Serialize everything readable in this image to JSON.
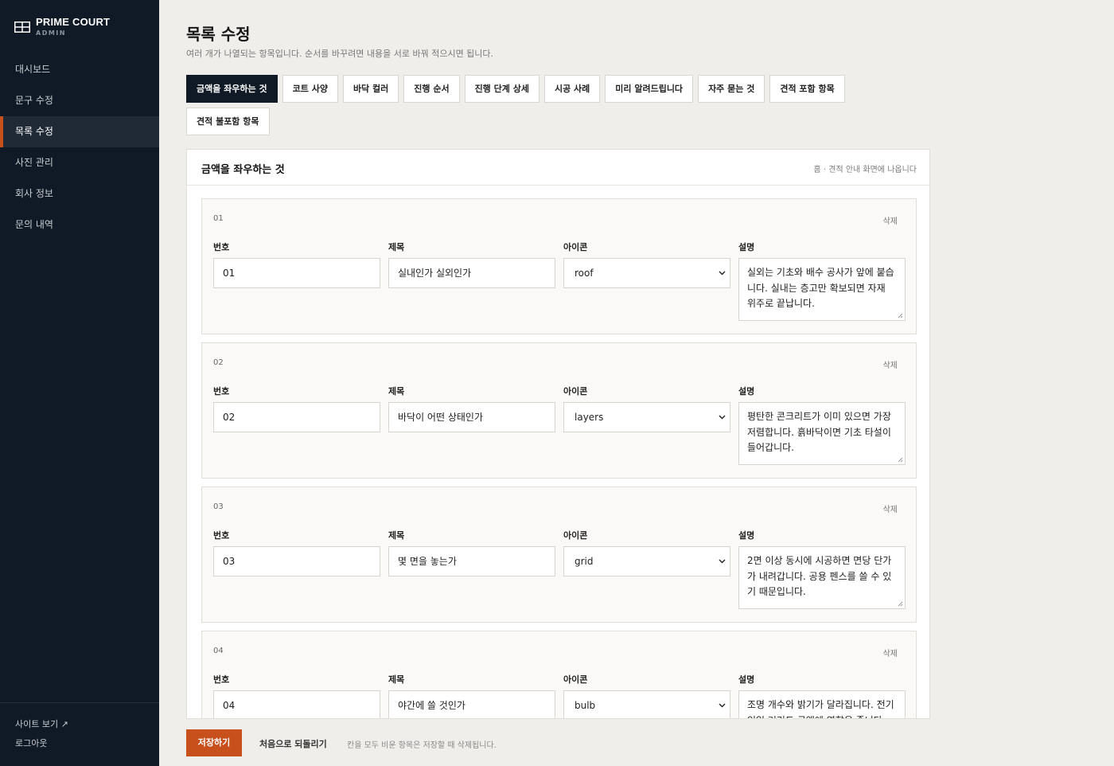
{
  "sidebar": {
    "brand": {
      "name": "PRIME COURT",
      "sub": "ADMIN"
    },
    "nav": [
      {
        "label": "대시보드"
      },
      {
        "label": "문구 수정"
      },
      {
        "label": "목록 수정",
        "active": true
      },
      {
        "label": "사진 관리"
      },
      {
        "label": "회사 정보"
      },
      {
        "label": "문의 내역"
      }
    ],
    "footer": {
      "view_site": "사이트 보기 ↗",
      "logout": "로그아웃"
    }
  },
  "header": {
    "title": "목록 수정",
    "description": "여러 개가 나열되는 항목입니다. 순서를 바꾸려면 내용을 서로 바꿔 적으시면 됩니다."
  },
  "tabs": [
    {
      "label": "금액을 좌우하는 것",
      "active": true
    },
    {
      "label": "코트 사양"
    },
    {
      "label": "바닥 컬러"
    },
    {
      "label": "진행 순서"
    },
    {
      "label": "진행 단계 상세"
    },
    {
      "label": "시공 사례"
    },
    {
      "label": "미리 알려드립니다"
    },
    {
      "label": "자주 묻는 것"
    },
    {
      "label": "견적 포함 항목"
    },
    {
      "label": "견적 불포함 항목"
    }
  ],
  "panel": {
    "title": "금액을 좌우하는 것",
    "note": "홈 · 견적 안내 화면에 나옵니다",
    "labels": {
      "number": "번호",
      "title": "제목",
      "icon": "아이콘",
      "description": "설명"
    },
    "delete_label": "삭제",
    "items": [
      {
        "index": "01",
        "number": "01",
        "title": "실내인가 실외인가",
        "icon": "roof",
        "description": "실외는 기초와 배수 공사가 앞에 붙습니다. 실내는 층고만 확보되면 자재 위주로 끝납니다."
      },
      {
        "index": "02",
        "number": "02",
        "title": "바닥이 어떤 상태인가",
        "icon": "layers",
        "description": "평탄한 콘크리트가 이미 있으면 가장 저렴합니다. 흙바닥이면 기초 타설이 들어갑니다."
      },
      {
        "index": "03",
        "number": "03",
        "title": "몇 면을 놓는가",
        "icon": "grid",
        "description": "2면 이상 동시에 시공하면 면당 단가가 내려갑니다. 공용 펜스를 쓸 수 있기 때문입니다."
      },
      {
        "index": "04",
        "number": "04",
        "title": "야간에 쓸 것인가",
        "icon": "bulb",
        "description": "조명 개수와 밝기가 달라집니다. 전기 인입 거리도 금액에 영향을 줍니다."
      }
    ]
  },
  "footer": {
    "save": "저장하기",
    "reset": "처음으로 되돌리기",
    "note": "칸을 모두 비운 항목은 저장할 때 삭제됩니다."
  },
  "colors": {
    "sidebar_bg": "#101a26",
    "accent": "#c8501c",
    "page_bg": "#f0eeea"
  }
}
